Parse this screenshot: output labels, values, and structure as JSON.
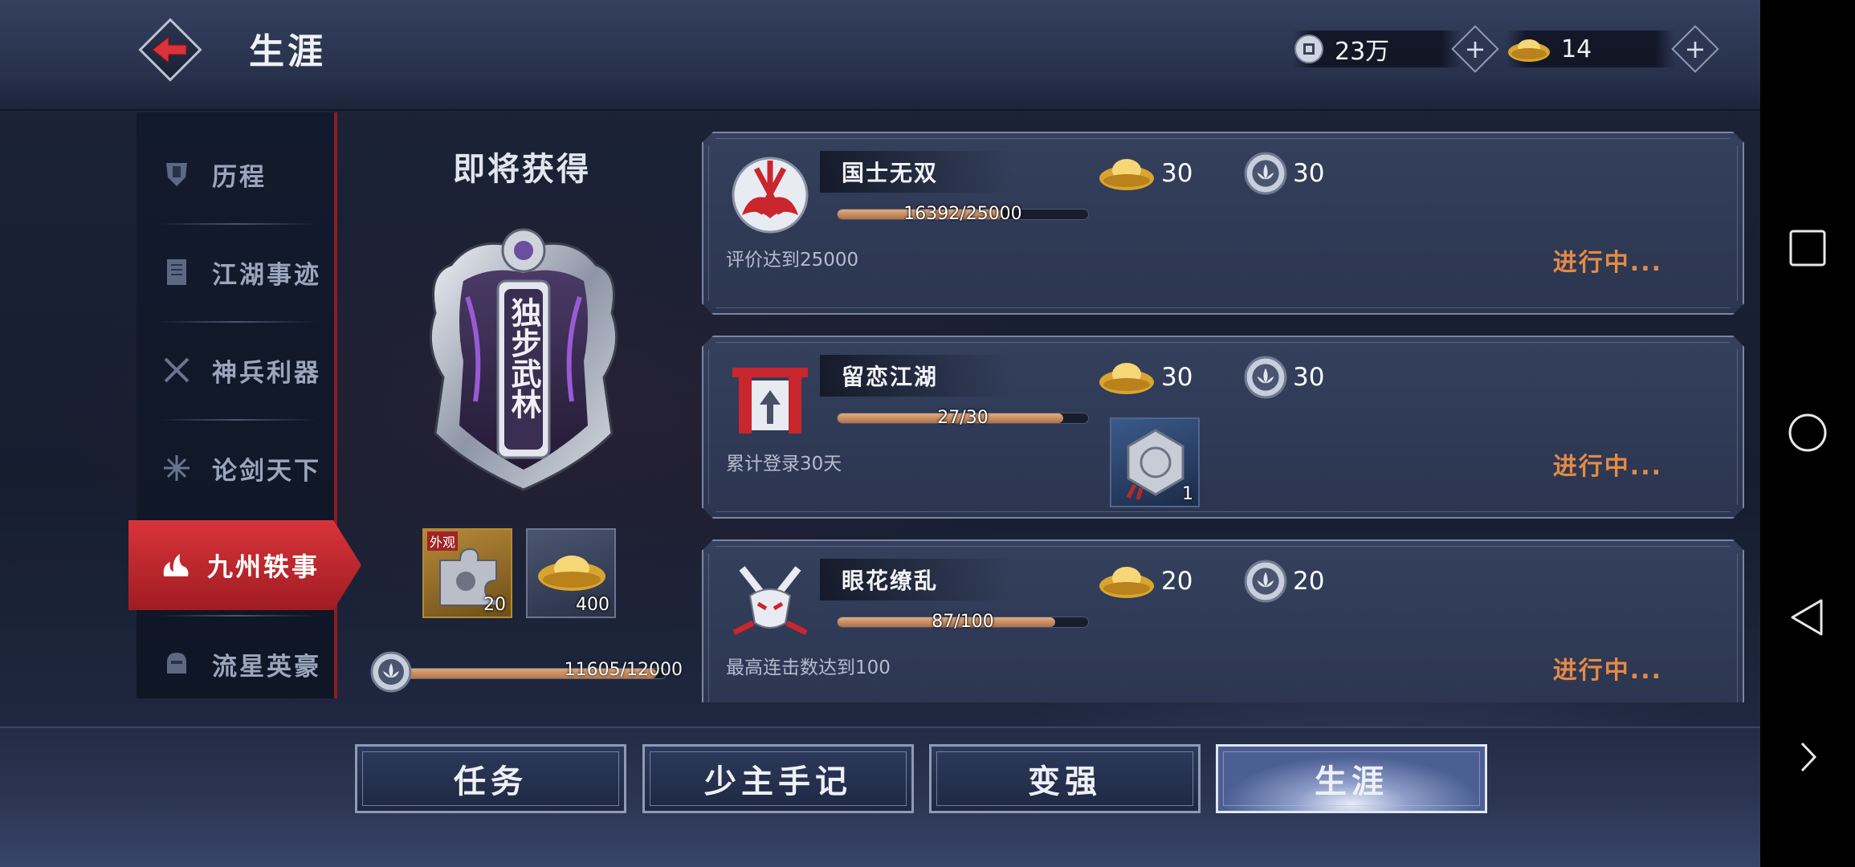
{
  "header": {
    "title": "生涯",
    "currency_silver": "23万",
    "currency_gold": "14"
  },
  "sidebar": {
    "items": [
      {
        "label": "历程"
      },
      {
        "label": "江湖事迹"
      },
      {
        "label": "神兵利器"
      },
      {
        "label": "论剑天下"
      },
      {
        "label": "九州轶事"
      },
      {
        "label": "流星英豪"
      }
    ],
    "active_index": 4
  },
  "reward_panel": {
    "title": "即将获得",
    "badge_text": "独步武林",
    "items": [
      {
        "tag": "外观",
        "count": "20"
      },
      {
        "count": "400"
      }
    ],
    "progress_text": "11605/12000",
    "progress_fraction": 0.967
  },
  "tasks": [
    {
      "name": "国士无双",
      "progress_text": "16392/25000",
      "progress_fraction": 0.656,
      "description": "评价达到25000",
      "gold_reward": "30",
      "lotus_reward": "30",
      "status": "进行中..."
    },
    {
      "name": "留恋江湖",
      "progress_text": "27/30",
      "progress_fraction": 0.9,
      "description": "累计登录30天",
      "gold_reward": "30",
      "lotus_reward": "30",
      "extra_item_count": "1",
      "status": "进行中..."
    },
    {
      "name": "眼花缭乱",
      "progress_text": "87/100",
      "progress_fraction": 0.87,
      "description": "最高连击数达到100",
      "gold_reward": "20",
      "lotus_reward": "20",
      "status": "进行中..."
    }
  ],
  "bottom_tabs": [
    {
      "label": "任务"
    },
    {
      "label": "少主手记"
    },
    {
      "label": "变强"
    },
    {
      "label": "生涯"
    }
  ],
  "active_tab": 3,
  "colors": {
    "accent_red": "#c8262d",
    "status_orange": "#e58a45",
    "progress_fill": "#c98658"
  }
}
